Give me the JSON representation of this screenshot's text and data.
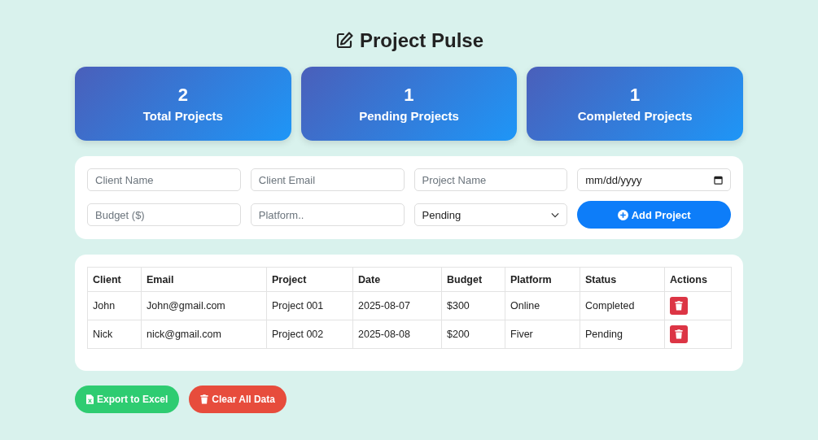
{
  "title": "Project Pulse",
  "stats": [
    {
      "value": "2",
      "label": "Total Projects"
    },
    {
      "value": "1",
      "label": "Pending Projects"
    },
    {
      "value": "1",
      "label": "Completed Projects"
    }
  ],
  "form": {
    "fields": [
      {
        "kind": "text",
        "placeholder": "Client Name"
      },
      {
        "kind": "text",
        "placeholder": "Client Email"
      },
      {
        "kind": "text",
        "placeholder": "Project Name"
      },
      {
        "kind": "date",
        "placeholder": "mm/dd/yyyy"
      },
      {
        "kind": "text",
        "placeholder": "Budget ($)"
      },
      {
        "kind": "text",
        "placeholder": "Platform.."
      },
      {
        "kind": "select",
        "value": "Pending"
      }
    ],
    "submit": "Add Project"
  },
  "table": {
    "columns": [
      "Client",
      "Email",
      "Project",
      "Date",
      "Budget",
      "Platform",
      "Status",
      "Actions"
    ],
    "rows": [
      [
        "John",
        "John@gmail.com",
        "Project 001",
        "2025-08-07",
        "$300",
        "Online",
        "Completed"
      ],
      [
        "Nick",
        "nick@gmail.com",
        "Project 002",
        "2025-08-08",
        "$200",
        "Fiver",
        "Pending"
      ]
    ]
  },
  "actions": [
    {
      "kind": "export",
      "label": "Export to Excel"
    },
    {
      "kind": "clear",
      "label": "Clear All Data"
    }
  ]
}
